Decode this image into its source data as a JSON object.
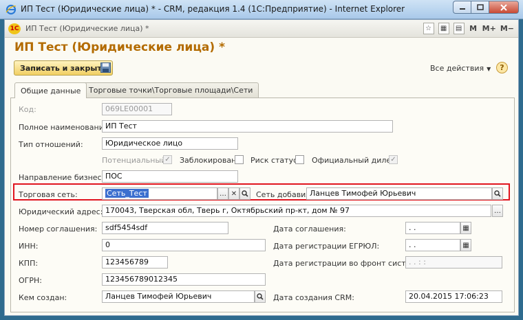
{
  "window": {
    "title": "ИП Тест (Юридические лица) * - CRM, редакция 1.4 (1С:Предприятие) - Internet Explorer"
  },
  "toolbar": {
    "tab_title": "ИП Тест (Юридические лица) *",
    "tools": [
      "M",
      "M+",
      "M−"
    ]
  },
  "form": {
    "title": "ИП Тест (Юридические лица) *",
    "save_close_label": "Записать и закрыть",
    "all_actions_label": "Все действия",
    "help_label": "?",
    "tabs": [
      "Общие данные",
      "Торговые точки\\Торговые площади\\Сети"
    ]
  },
  "fields": {
    "code": {
      "label": "Код:",
      "value": "069LE00001"
    },
    "full_name": {
      "label": "Полное наименование:",
      "value": "ИП Тест"
    },
    "relation_type": {
      "label": "Тип отношений:",
      "value": "Юридическое лицо"
    },
    "potential": {
      "label": "Потенциальный:",
      "checked": true
    },
    "blocked": {
      "label": "Заблокирован:",
      "checked": false
    },
    "risk": {
      "label": "Риск статус:",
      "checked": false
    },
    "official_dealer": {
      "label": "Официальный дилер:",
      "checked": true
    },
    "business_direction": {
      "label": "Направление бизнеса:",
      "value": "ПОС"
    },
    "trade_network": {
      "label": "Торговая сеть:",
      "value": "Сеть_Тест"
    },
    "network_added": {
      "label": "Сеть добавил",
      "value": "Ланцев Тимофей Юрьевич"
    },
    "legal_address": {
      "label": "Юридический адрес:",
      "value": "170043, Тверская обл, Тверь г, Октябрьский пр-кт, дом № 97"
    },
    "agreement_number": {
      "label": "Номер соглашения:",
      "value": "sdf5454sdf"
    },
    "inn": {
      "label": "ИНН:",
      "value": "0"
    },
    "kpp": {
      "label": "КПП:",
      "value": "123456789"
    },
    "ogrn": {
      "label": "ОГРН:",
      "value": "123456789012345"
    },
    "created_by": {
      "label": "Кем создан:",
      "value": "Ланцев Тимофей Юрьевич"
    },
    "agreement_date": {
      "label": "Дата соглашения:",
      "value": ". ."
    },
    "egrul_date": {
      "label": "Дата регистрации ЕГРЮЛ:",
      "value": ". ."
    },
    "front_date": {
      "label": "Дата регистрации во фронт системе:",
      "value": ". .    : :"
    },
    "crm_created_date": {
      "label": "Дата создания CRM:",
      "value": "20.04.2015 17:06:23"
    }
  }
}
